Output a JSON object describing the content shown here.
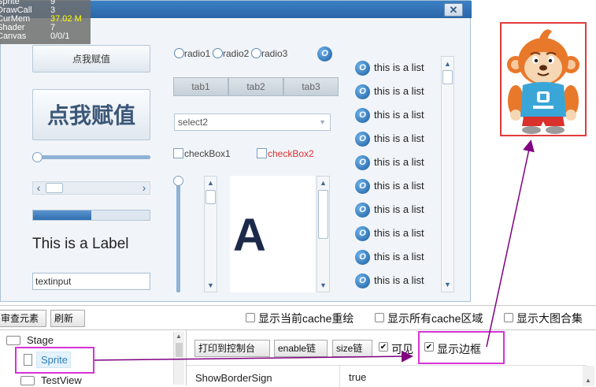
{
  "stats": [
    {
      "name": "Sprite",
      "value": "9",
      "color": "#ffffff"
    },
    {
      "name": "DrawCall",
      "value": "3",
      "color": "#ffffff"
    },
    {
      "name": "CurMem",
      "value": "37.02 M",
      "color": "#ffff00"
    },
    {
      "name": "Shader",
      "value": "7",
      "color": "#ffffff"
    },
    {
      "name": "Canvas",
      "value": "0/0/1",
      "color": "#ffffff"
    }
  ],
  "window": {
    "close_label": "✕"
  },
  "buttons": {
    "small": "点我赋值",
    "big": "点我赋值"
  },
  "slider": {
    "value": 0.0
  },
  "hscroll": {
    "left": "‹",
    "right": "›"
  },
  "progress": {
    "value": 0.5
  },
  "label": {
    "text": "This is a Label"
  },
  "textinput": {
    "value": "textinput"
  },
  "radios": [
    {
      "label": "radio1"
    },
    {
      "label": "radio2"
    },
    {
      "label": "radio3"
    }
  ],
  "tabs": [
    {
      "label": "tab1"
    },
    {
      "label": "tab2"
    },
    {
      "label": "tab3"
    }
  ],
  "select": {
    "value": "select2"
  },
  "checkboxes": [
    {
      "label": "checkBox1",
      "color": "#444444"
    },
    {
      "label": "checkBox2",
      "color": "#e03030"
    }
  ],
  "list": {
    "icon": "o-icon",
    "items": [
      "this is a list",
      "this is a list",
      "this is a list",
      "this is a list",
      "this is a list",
      "this is a list",
      "this is a list",
      "this is a list",
      "this is a list",
      "this is a list"
    ]
  },
  "scroll_arrows": {
    "up": "▲",
    "down": "▼"
  },
  "debug_toolbar": {
    "inspect_label": "审查元素",
    "refresh_label": "刷新",
    "options": [
      {
        "label": "显示当前cache重绘",
        "checked": false
      },
      {
        "label": "显示所有cache区域",
        "checked": false
      },
      {
        "label": "显示大图合集",
        "checked": false
      }
    ]
  },
  "tree": {
    "items": [
      {
        "label": "Stage",
        "icon": "folder-icon"
      },
      {
        "label": "Sprite",
        "icon": "file-icon",
        "selected": true
      },
      {
        "label": "TestView",
        "icon": "folder-icon"
      }
    ]
  },
  "props_toolbar": {
    "print_label": "打印到控制台",
    "enable_label": "enable链",
    "size_label": "size链",
    "visible_label": "可见",
    "visible_checked": true,
    "border_label": "显示边框",
    "border_checked": true
  },
  "props_table": {
    "rows": [
      {
        "key": "ShowBorderSign",
        "value": "true"
      }
    ]
  },
  "colors": {
    "highlight": "#d633d6",
    "arrow": "#800080",
    "image_border": "#e23b3b"
  }
}
